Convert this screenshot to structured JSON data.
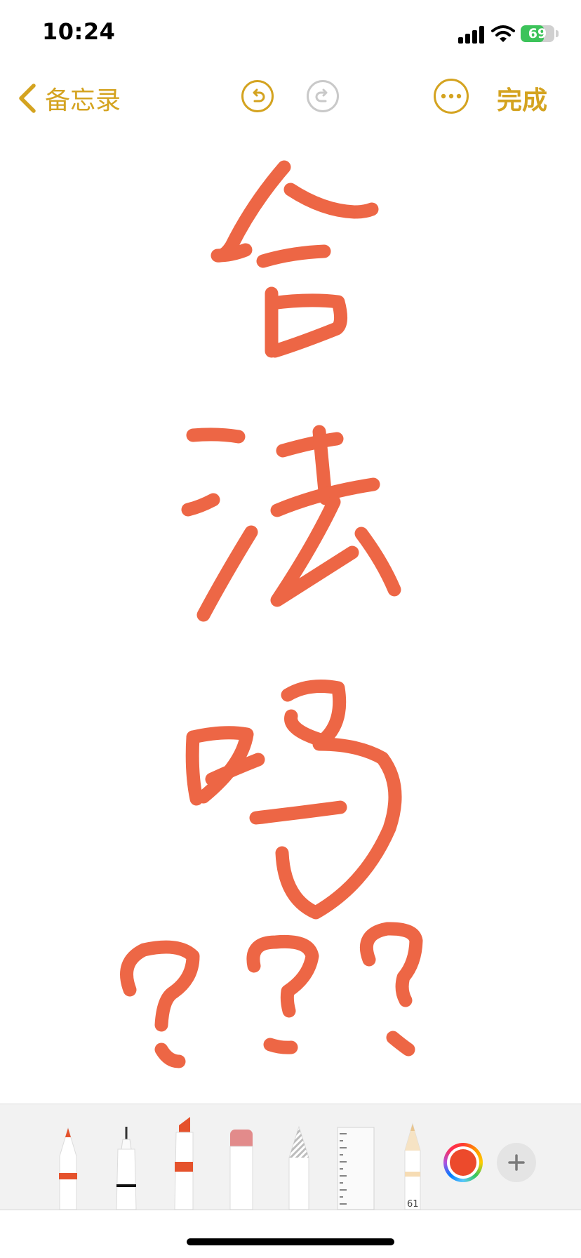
{
  "status_bar": {
    "time": "10:24",
    "battery_level": "69",
    "battery_fraction": 0.69,
    "battery_color": "#3cc35a",
    "charging": true
  },
  "nav": {
    "back_label": "备忘录",
    "back_icon": "chevron-left-icon",
    "undo_icon": "undo-icon",
    "redo_icon": "redo-icon",
    "redo_enabled": false,
    "more_icon": "ellipsis-icon",
    "done_label": "完成",
    "accent_color": "#d4a320"
  },
  "drawing": {
    "ink_color": "#ec5a36",
    "handwritten_text": "合法吗???"
  },
  "toolbar": {
    "tools": [
      "pen",
      "monoline",
      "marker",
      "eraser",
      "lasso",
      "ruler",
      "pencil"
    ],
    "pencil_width_label": "61",
    "selected_color": "#ec4a2c",
    "color_picker_icon": "color-wheel-icon",
    "add_icon": "plus-icon"
  }
}
